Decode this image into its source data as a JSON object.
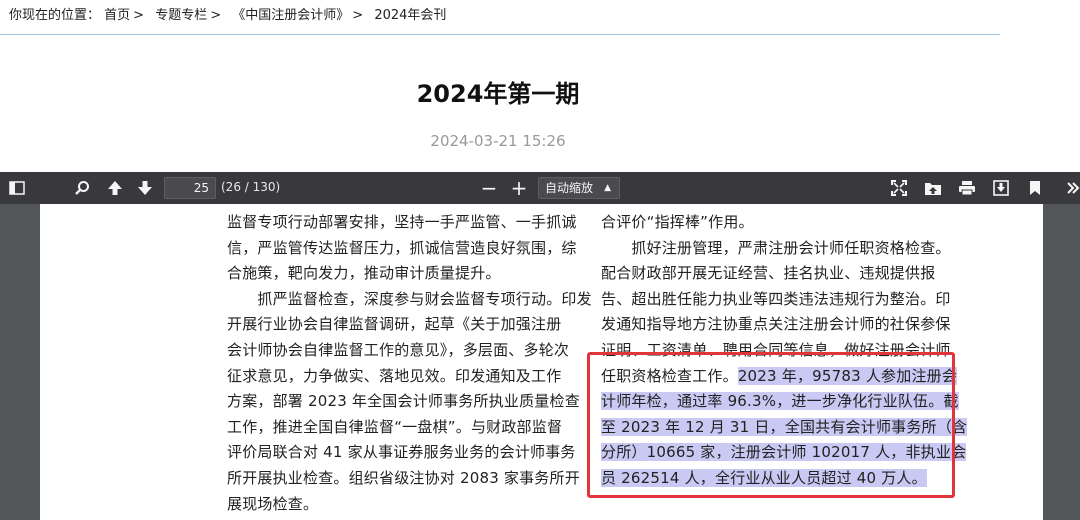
{
  "breadcrumb": {
    "prefix": "你现在的位置：",
    "items": [
      "首页",
      "专题专栏",
      "《中国注册会计师》",
      "2024年会刊"
    ],
    "separator": ">"
  },
  "article": {
    "title": "2024年第一期",
    "date": "2024-03-21 15:26"
  },
  "pdf_toolbar": {
    "page_number": "25",
    "page_count": "(26 / 130)",
    "zoom_label": "自动缩放",
    "minus": "−",
    "plus": "+",
    "icons": [
      "sidebar-toggle-icon",
      "search-icon",
      "previous-page-icon",
      "next-page-icon",
      "zoom-out-icon",
      "zoom-in-icon",
      "presentation-mode-icon",
      "open-file-icon",
      "print-icon",
      "download-icon",
      "bookmark-icon",
      "tools-icon"
    ]
  },
  "document": {
    "left_column": [
      "监督专项行动部署安排，坚持一手严监管、一手抓诚",
      "信，严监管传达监督压力，抓诚信营造良好氛围，综",
      "合施策，靶向发力，推动审计质量提升。",
      "　　抓严监督检查，深度参与财会监督专项行动。印发",
      "开展行业协会自律监督调研，起草《关于加强注册",
      "会计师协会自律监督工作的意见》，多层面、多轮次",
      "征求意见，力争做实、落地见效。印发通知及工作",
      "方案，部署 2023 年全国会计师事务所执业质量检查",
      "工作，推进全国自律监督“一盘棋”。与财政部监督",
      "评价局联合对 41 家从事证券服务业务的会计师事务",
      "所开展执业检查。组织省级注协对 2083 家事务所开",
      "展现场检查。"
    ],
    "right_column": [
      "合评价“指挥棒”作用。",
      "　　抓好注册管理，严肃注册会计师任职资格检查。",
      "配合财政部开展无证经营、挂名执业、违规提供报",
      "告、超出胜任能力执业等四类违法违规行为整治。印",
      "发通知指导地方注协重点关注注册会计师的社保参保",
      "证明、工资清单、聘用合同等信息，做好注册会计师"
    ],
    "highlight_intro": "任职资格检查工作。",
    "highlight_lines": [
      "2023 年，95783 人参加注册会",
      "计师年检，通过率 96.3%，进一步净化行业队伍。截",
      "至 2023 年 12 月 31 日，全国共有会计师事务所（含",
      "分所）10665 家，注册会计师 102017 人，非执业会",
      "员 262514 人，全行业从业人员超过 40 万人。"
    ]
  },
  "colors": {
    "toolbar_bg": "#38383d",
    "viewer_bg": "#525659",
    "highlight": "#c9c9f3",
    "annotation_box": "#e2353b",
    "divider": "#9fc3de"
  }
}
